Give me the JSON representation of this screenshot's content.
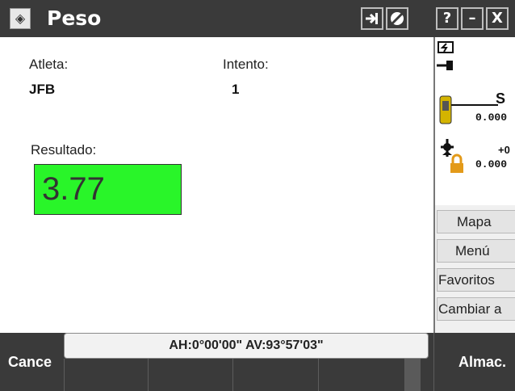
{
  "window": {
    "title": "Peso",
    "icons": [
      "app-icon",
      "signal-icon",
      "stop-icon",
      "help-icon",
      "minimize-icon",
      "close-icon"
    ],
    "help_glyph": "?",
    "minimize_glyph": "–",
    "close_glyph": "X"
  },
  "form": {
    "athlete_label": "Atleta:",
    "athlete_value": "JFB",
    "attempt_label": "Intento:",
    "attempt_value": "1",
    "result_label": "Resultado:",
    "result_value": "3.77",
    "result_color": "#29f529"
  },
  "sidebar": {
    "status": {
      "s_label": "S",
      "value1": "0.000",
      "plus_label": "+0",
      "value2": "0.000"
    },
    "buttons": [
      "Mapa",
      "Menú",
      "Favoritos",
      "Cambiar a"
    ]
  },
  "bottom_bar": {
    "cancel_label": "Cance",
    "angles": "AH:0°00'00\"  AV:93°57'03\"",
    "store_label": "Almac."
  }
}
